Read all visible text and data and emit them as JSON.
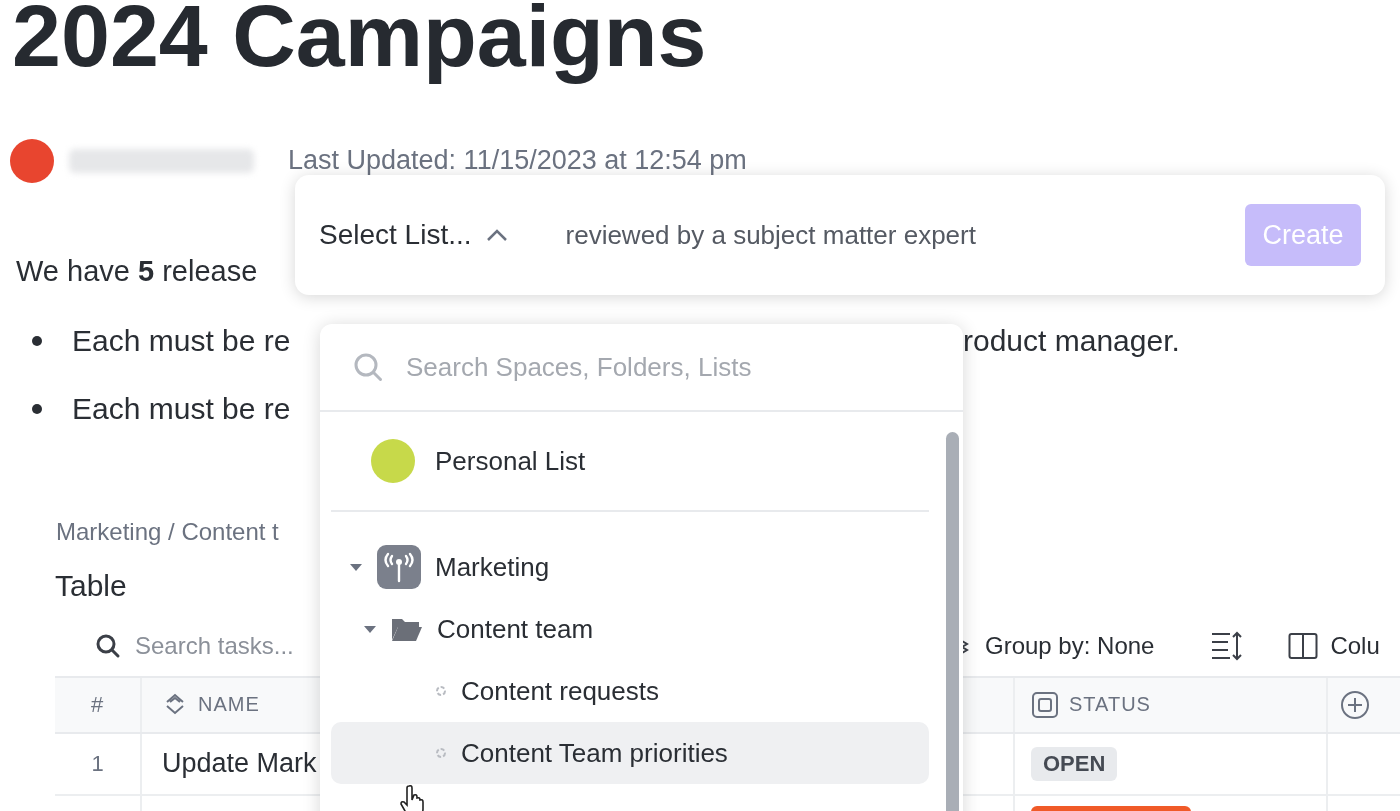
{
  "page": {
    "title": "2024 Campaigns",
    "last_updated": "Last Updated: 11/15/2023 at 12:54 pm",
    "intro": "We have **5** release",
    "bullets": [
      {
        "left": "Each must be re",
        "right": "roduct manager."
      },
      {
        "left": "Each must be re"
      }
    ]
  },
  "table_view": {
    "breadcrumb": "Marketing / Content t",
    "title": "Table",
    "search_placeholder": "Search tasks...",
    "group_by": "Group by: None",
    "columns_button": "Colu",
    "columns": [
      "#",
      "NAME",
      "STATUS"
    ],
    "rows": [
      {
        "number": "1",
        "name": "Update Mark",
        "status": "OPEN",
        "color": "#e8eaed"
      },
      {
        "color": "#f05a28"
      }
    ]
  },
  "create_bar": {
    "list_select": "Select List...",
    "task_name": "reviewed by a subject matter expert",
    "create_button": "Create",
    "disabled": true
  },
  "list_picker": {
    "search_placeholder": "Search Spaces, Folders, Lists",
    "personal": {
      "label": "Personal List",
      "selected": false
    },
    "spaces": [
      {
        "label": "Marketing",
        "kind": "space",
        "expanded": true,
        "selected": false,
        "children": [
          {
            "label": "Content team",
            "kind": "folder",
            "expanded": true,
            "selected": false,
            "children": [
              {
                "label": "Content requests",
                "kind": "list",
                "selected": false
              },
              {
                "label": "Content Team priorities",
                "kind": "list",
                "selected": true
              }
            ]
          }
        ]
      }
    ]
  }
}
